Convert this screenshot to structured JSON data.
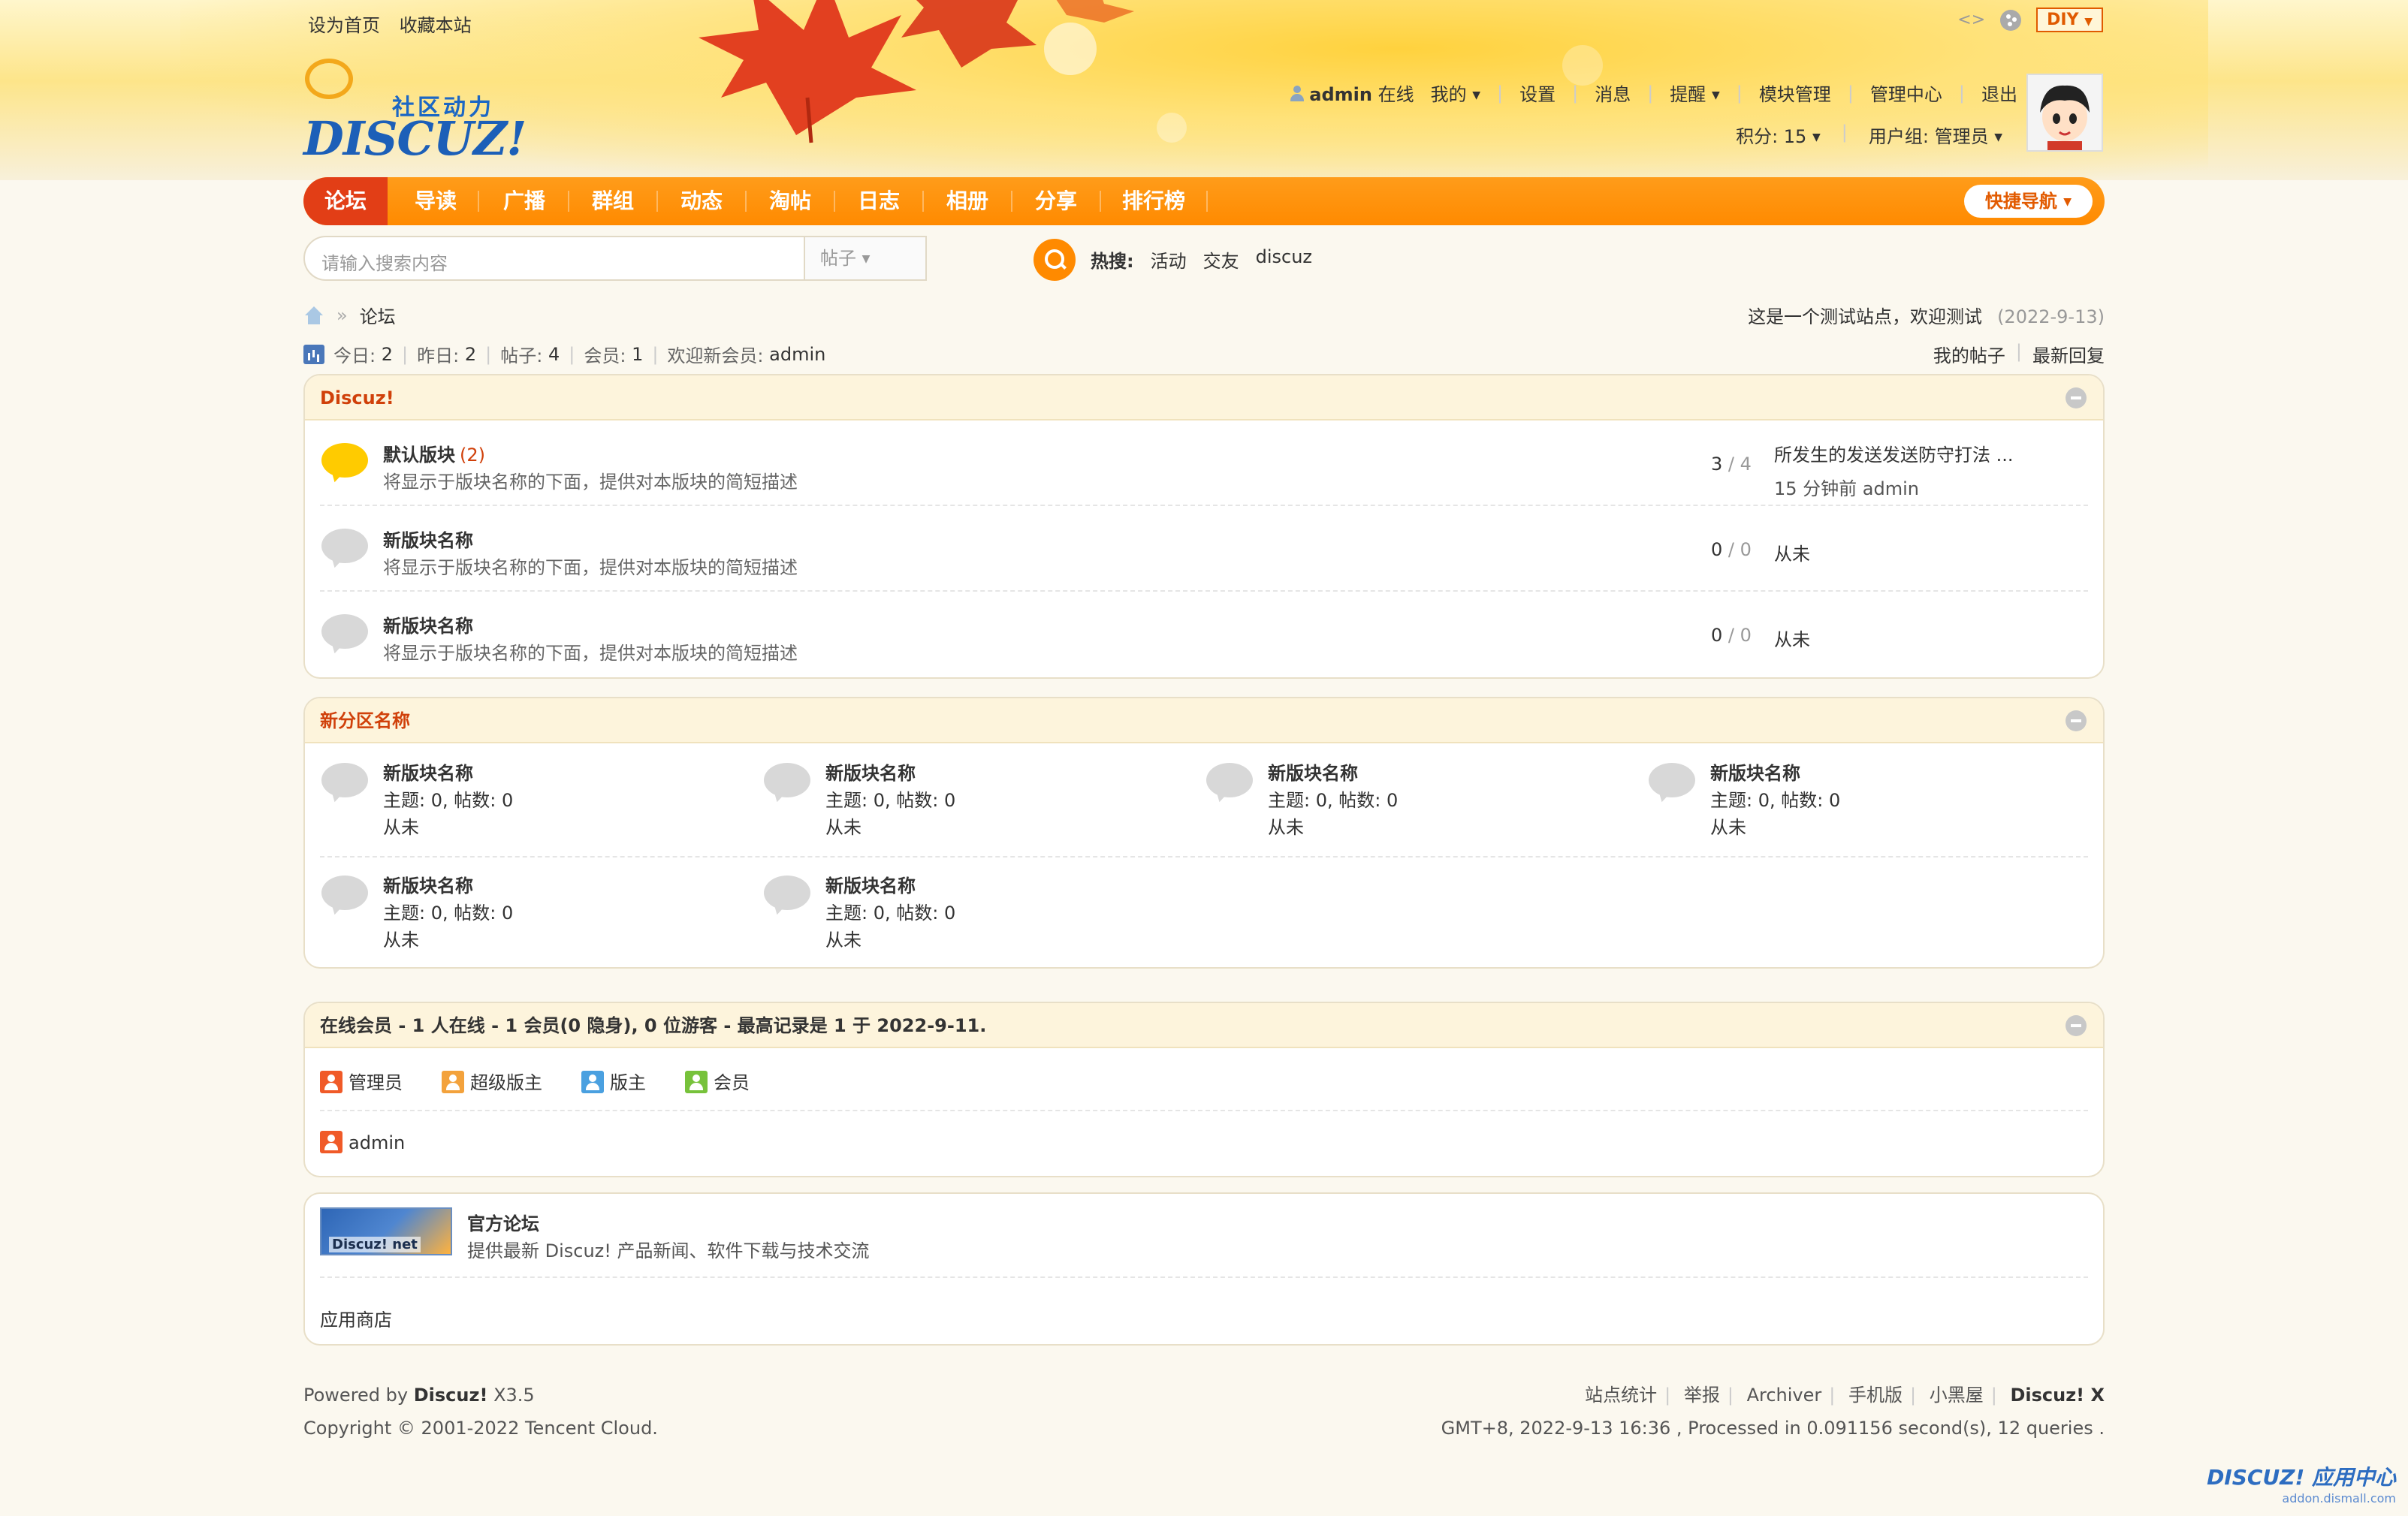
{
  "top": {
    "set_home": "设为首页",
    "bookmark": "收藏本站",
    "diy": "DIY"
  },
  "logo": {
    "cn": "社区动力",
    "en": "DISCUZ!"
  },
  "user": {
    "name": "admin",
    "status": "在线",
    "menu": [
      "我的",
      "设置",
      "消息",
      "提醒",
      "模块管理",
      "管理中心",
      "退出"
    ],
    "points": "积分: 15",
    "group": "用户组: 管理员"
  },
  "nav": {
    "items": [
      "论坛",
      "导读",
      "广播",
      "群组",
      "动态",
      "淘帖",
      "日志",
      "相册",
      "分享",
      "排行榜"
    ],
    "quick": "快捷导航"
  },
  "search": {
    "placeholder": "请输入搜索内容",
    "type": "帖子",
    "hot_label": "热搜:",
    "hot": [
      "活动",
      "交友",
      "discuz"
    ]
  },
  "breadcrumb": {
    "current": "论坛"
  },
  "notice": {
    "text": "这是一个测试站点，欢迎测试",
    "date": "(2022-9-13)"
  },
  "stats": {
    "today_label": "今日:",
    "today": "2",
    "yesterday_label": "昨日:",
    "yesterday": "2",
    "posts_label": "帖子:",
    "posts": "4",
    "members_label": "会员:",
    "members": "1",
    "newest_label": "欢迎新会员:",
    "newest": "admin",
    "my_posts": "我的帖子",
    "latest_reply": "最新回复"
  },
  "cat1": {
    "title": "Discuz!",
    "forums": [
      {
        "name": "默认版块",
        "count": "(2)",
        "desc": "将显示于版块名称的下面，提供对本版块的简短描述",
        "threads": "3",
        "posts": "4",
        "last_title": "所发生的发送发送防守打法 ...",
        "last_info": "15 分钟前 admin"
      },
      {
        "name": "新版块名称",
        "desc": "将显示于版块名称的下面，提供对本版块的简短描述",
        "threads": "0",
        "posts": "0",
        "last_title": "从未"
      },
      {
        "name": "新版块名称",
        "desc": "将显示于版块名称的下面，提供对本版块的简短描述",
        "threads": "0",
        "posts": "0",
        "last_title": "从未"
      }
    ]
  },
  "cat2": {
    "title": "新分区名称",
    "forums": [
      {
        "name": "新版块名称",
        "stats": "主题: 0, 帖数: 0",
        "last": "从未"
      },
      {
        "name": "新版块名称",
        "stats": "主题: 0, 帖数: 0",
        "last": "从未"
      },
      {
        "name": "新版块名称",
        "stats": "主题: 0, 帖数: 0",
        "last": "从未"
      },
      {
        "name": "新版块名称",
        "stats": "主题: 0, 帖数: 0",
        "last": "从未"
      },
      {
        "name": "新版块名称",
        "stats": "主题: 0, 帖数: 0",
        "last": "从未"
      },
      {
        "name": "新版块名称",
        "stats": "主题: 0, 帖数: 0",
        "last": "从未"
      }
    ]
  },
  "online": {
    "title": "在线会员 - 1 人在线 - 1 会员(0 隐身), 0 位游客 - 最高记录是 1 于 2022-9-11.",
    "legend": [
      {
        "label": "管理员",
        "color": "#f05a28"
      },
      {
        "label": "超级版主",
        "color": "#f3a23c"
      },
      {
        "label": "版主",
        "color": "#4aa0e0"
      },
      {
        "label": "会员",
        "color": "#77c23b"
      }
    ],
    "users": [
      "admin"
    ]
  },
  "links": {
    "img_text": "Discuz! net",
    "title": "官方论坛",
    "desc": "提供最新 Discuz! 产品新闻、软件下载与技术交流",
    "text_link": "应用商店"
  },
  "footer": {
    "powered_prefix": "Powered by",
    "powered_brand": "Discuz!",
    "version": "X3.5",
    "copyright": "Copyright © 2001-2022 Tencent Cloud.",
    "links": [
      "站点统计",
      "举报",
      "Archiver",
      "手机版",
      "小黑屋",
      "Discuz! X"
    ],
    "processed": "GMT+8, 2022-9-13 16:36 , Processed in 0.091156 second(s), 12 queries ."
  },
  "watermark": {
    "title": "DISCUZ! 应用中心",
    "url": "addon.dismall.com"
  },
  "colors": {
    "accent": "#ff8a00",
    "active_nav": "#e23e16",
    "category_title": "#d0400a"
  }
}
